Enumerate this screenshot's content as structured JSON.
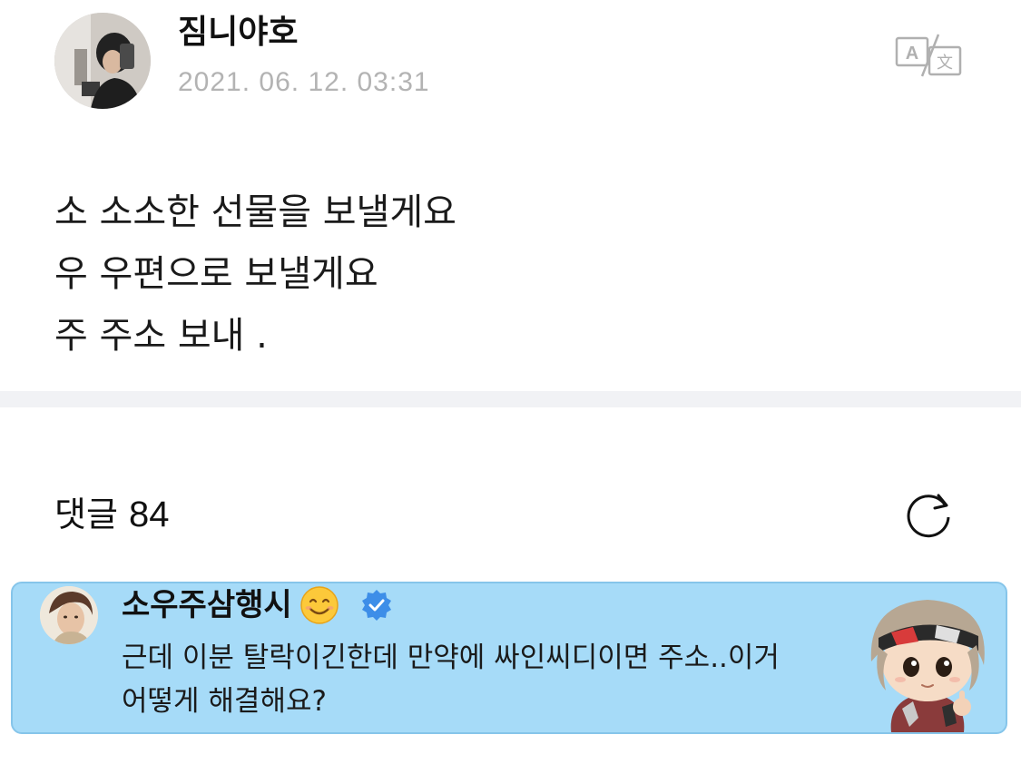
{
  "post": {
    "author": "짐니야호",
    "timestamp": "2021. 06. 12. 03:31",
    "translate_icon": "translate-icon",
    "lines": [
      "소 소소한 선물을 보낼게요",
      "우 우편으로 보낼게요",
      "주 주소 보내 ."
    ]
  },
  "comments": {
    "label": "댓글",
    "count": "84",
    "refresh_icon": "refresh-icon",
    "highlighted": {
      "author": "소우주삼행시",
      "emoji": "smiling-face-emoji",
      "badge": "verified-badge-icon",
      "text": "근데 이분 탈락이긴한데 만약에 싸인씨디이면 주소..이거 어떻게 해결해요?",
      "sticker": "character-sticker"
    }
  },
  "colors": {
    "highlight_bg": "#a6dbf8",
    "highlight_border": "#86c5ea",
    "timestamp": "#b3b3b3",
    "verified": "#3d8ee8",
    "divider": "#f1f2f5"
  }
}
